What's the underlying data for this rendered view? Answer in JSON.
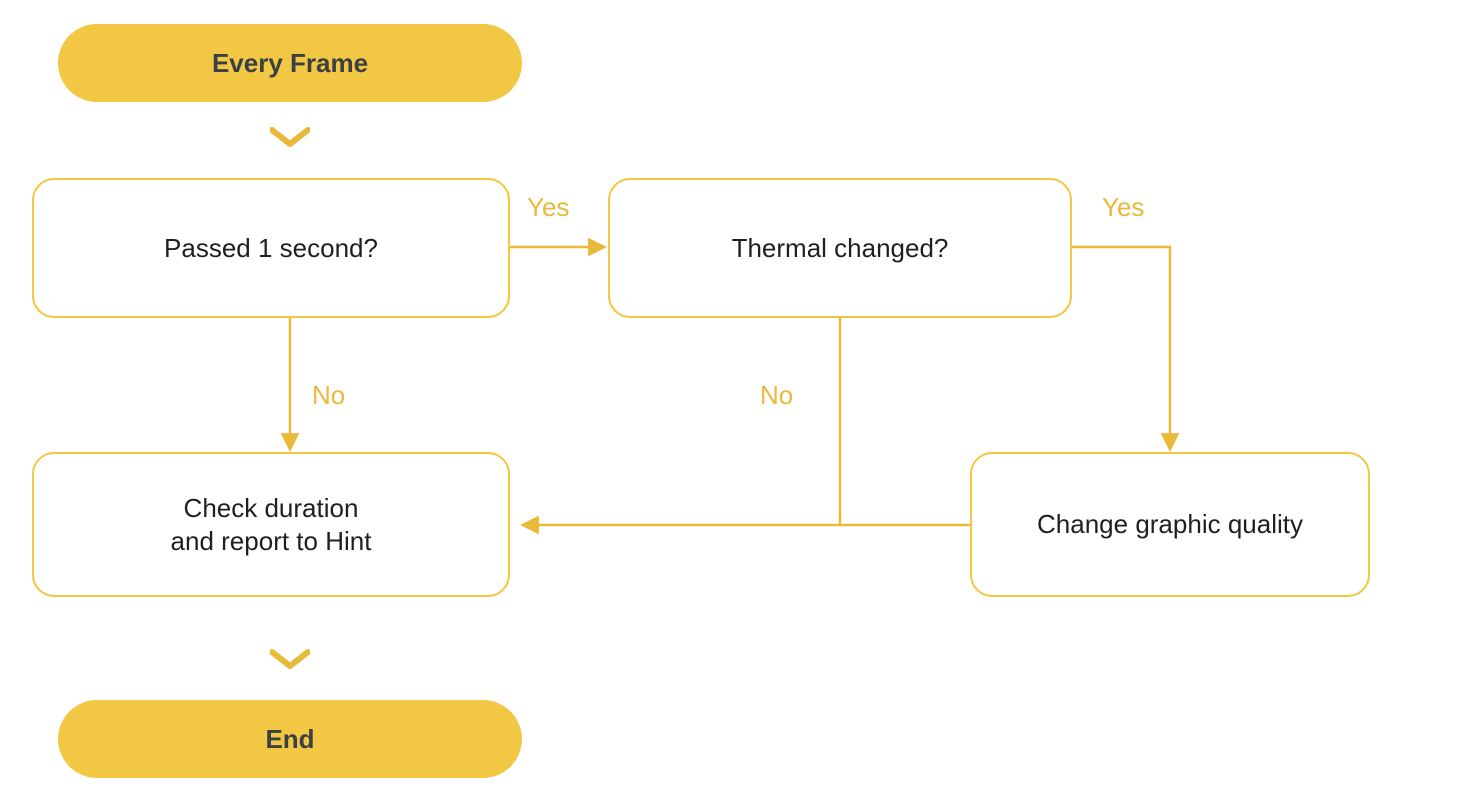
{
  "colors": {
    "accent": "#f2c744",
    "accent_stroke": "#e9b93a",
    "text_dark": "#3c4043",
    "text_body": "#1f1f1f",
    "bg": "#ffffff"
  },
  "nodes": {
    "start": {
      "label": "Every Frame"
    },
    "passed": {
      "label": "Passed 1 second?"
    },
    "thermal": {
      "label": "Thermal changed?"
    },
    "check": {
      "label": "Check duration\nand report to Hint"
    },
    "change": {
      "label": "Change graphic quality"
    },
    "end": {
      "label": "End"
    }
  },
  "edges": {
    "passed_yes": {
      "label": "Yes"
    },
    "passed_no": {
      "label": "No"
    },
    "thermal_yes": {
      "label": "Yes"
    },
    "thermal_no": {
      "label": "No"
    }
  },
  "flow": [
    {
      "from": "start",
      "to": "passed",
      "condition": null
    },
    {
      "from": "passed",
      "to": "thermal",
      "condition": "Yes"
    },
    {
      "from": "passed",
      "to": "check",
      "condition": "No"
    },
    {
      "from": "thermal",
      "to": "change",
      "condition": "Yes"
    },
    {
      "from": "thermal",
      "to": "check",
      "condition": "No"
    },
    {
      "from": "change",
      "to": "check",
      "condition": null
    },
    {
      "from": "check",
      "to": "end",
      "condition": null
    }
  ]
}
